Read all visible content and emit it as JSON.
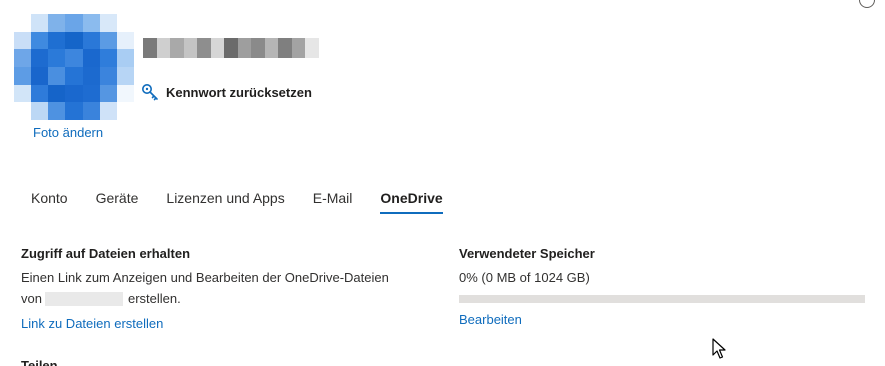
{
  "profile": {
    "change_photo_label": "Foto ändern",
    "reset_password_label": "Kennwort zurücksetzen",
    "reset_icon": "key-icon"
  },
  "tabs": [
    {
      "label": "Konto",
      "active": false
    },
    {
      "label": "Geräte",
      "active": false
    },
    {
      "label": "Lizenzen und Apps",
      "active": false
    },
    {
      "label": "E-Mail",
      "active": false
    },
    {
      "label": "OneDrive",
      "active": true
    }
  ],
  "onedrive": {
    "access": {
      "title": "Zugriff auf Dateien erhalten",
      "description_line1": "Einen Link zum Anzeigen und Bearbeiten der OneDrive-Dateien",
      "description_prefix": "von",
      "description_suffix": "erstellen.",
      "link_label": "Link zu Dateien erstellen"
    },
    "storage": {
      "title": "Verwendeter Speicher",
      "usage_text": "0% (0 MB of 1024 GB)",
      "used_fraction": 0,
      "edit_label": "Bearbeiten"
    },
    "next_section_title": "Teilen"
  },
  "colors": {
    "accent": "#0f6cbd",
    "progress_track": "#e1dfdd"
  }
}
